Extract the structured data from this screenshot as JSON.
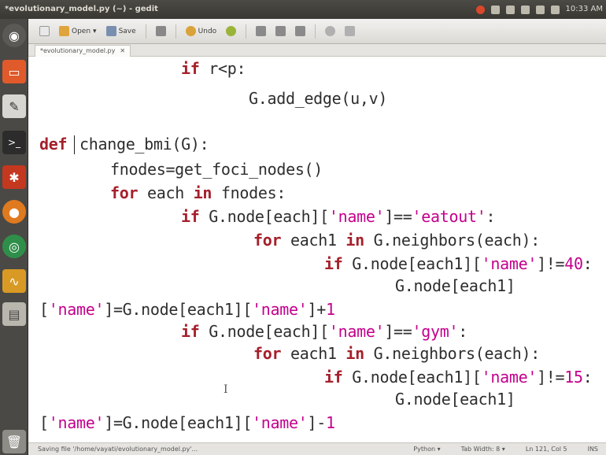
{
  "window": {
    "title": "*evolutionary_model.py (~) - gedit"
  },
  "tray": {
    "clock": "10:33 AM"
  },
  "toolbar": {
    "open_label": "Open",
    "save_label": "Save",
    "undo_label": "Undo"
  },
  "tab": {
    "label": "*evolutionary_model.py"
  },
  "code": {
    "l1_kw": "if",
    "l1_rest": " r<p:",
    "l2": "G.add_edge(u,v)",
    "l3_kw": "def",
    "l3_rest": "change_bmi(G):",
    "l4": "fnodes=get_foci_nodes()",
    "l5_kw1": "for",
    "l5_mid": " each ",
    "l5_kw2": "in",
    "l5_rest": " fnodes:",
    "l6_kw": "if",
    "l6_a": " G.node[each][",
    "l6_s1": "'name'",
    "l6_b": "]==",
    "l6_s2": "'eatout'",
    "l6_c": ":",
    "l7_kw1": "for",
    "l7_mid": " each1 ",
    "l7_kw2": "in",
    "l7_rest": " G.neighbors(each):",
    "l8_kw": "if",
    "l8_a": " G.node[each1][",
    "l8_s1": "'name'",
    "l8_b": "]!=",
    "l8_n": "40",
    "l8_c": ":",
    "l9": "G.node[each1]",
    "l10_a": "[",
    "l10_s1": "'name'",
    "l10_b": "]=G.node[each1][",
    "l10_s2": "'name'",
    "l10_c": "]+",
    "l10_n": "1",
    "l11_kw": "if",
    "l11_a": " G.node[each][",
    "l11_s1": "'name'",
    "l11_b": "]==",
    "l11_s2": "'gym'",
    "l11_c": ":",
    "l12_kw1": "for",
    "l12_mid": " each1 ",
    "l12_kw2": "in",
    "l12_rest": " G.neighbors(each):",
    "l13_kw": "if",
    "l13_a": " G.node[each1][",
    "l13_s1": "'name'",
    "l13_b": "]!=",
    "l13_n": "15",
    "l13_c": ":",
    "l14": "G.node[each1]",
    "l15_a": "[",
    "l15_s1": "'name'",
    "l15_b": "]=G.node[each1][",
    "l15_s2": "'name'",
    "l15_c": "]-",
    "l15_n": "1"
  },
  "statusbar": {
    "message": "Saving file '/home/vayati/evolutionary_model.py'...",
    "language": "Python ▾",
    "tab_width": "Tab Width: 8 ▾",
    "position": "Ln 121, Col 5",
    "mode": "INS"
  },
  "colors": {
    "keyword": "#a5202b",
    "string": "#c4008d",
    "panel": "#3c3b37"
  }
}
